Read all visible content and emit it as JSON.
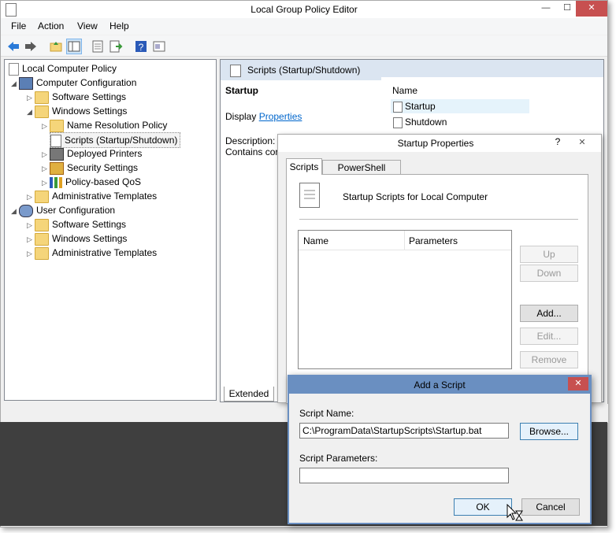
{
  "window": {
    "title": "Local Group Policy Editor",
    "minimize": "—",
    "maximize": "☐",
    "close": "✕"
  },
  "menu": [
    "File",
    "Action",
    "View",
    "Help"
  ],
  "tree": {
    "root": "Local Computer Policy",
    "computer": "Computer Configuration",
    "software": "Software Settings",
    "windows": "Windows Settings",
    "name_resolution": "Name Resolution Policy",
    "scripts": "Scripts (Startup/Shutdown)",
    "printers": "Deployed Printers",
    "security": "Security Settings",
    "qos": "Policy-based QoS",
    "admin": "Administrative Templates",
    "user": "User Configuration",
    "user_software": "Software Settings",
    "user_windows": "Windows Settings",
    "user_admin": "Administrative Templates"
  },
  "pane": {
    "header": "Scripts (Startup/Shutdown)",
    "heading": "Startup",
    "display_label": "Display",
    "properties_link": "Properties",
    "description_label": "Description:",
    "description_text": "Contains cor",
    "list_header": "Name",
    "items": [
      "Startup",
      "Shutdown"
    ],
    "tab_extended": "Extended"
  },
  "props": {
    "title": "Startup Properties",
    "help": "?",
    "close": "✕",
    "tab_scripts": "Scripts",
    "tab_powershell": "PowerShell Scripts",
    "caption": "Startup Scripts for Local Computer",
    "col_name": "Name",
    "col_params": "Parameters",
    "up": "Up",
    "down": "Down",
    "add": "Add...",
    "edit": "Edit...",
    "remove": "Remove"
  },
  "add": {
    "title": "Add a Script",
    "close": "✕",
    "name_label": "Script Name:",
    "name_value": "C:\\ProgramData\\StartupScripts\\Startup.bat",
    "browse": "Browse...",
    "params_label": "Script Parameters:",
    "params_value": "",
    "ok": "OK",
    "cancel": "Cancel"
  }
}
